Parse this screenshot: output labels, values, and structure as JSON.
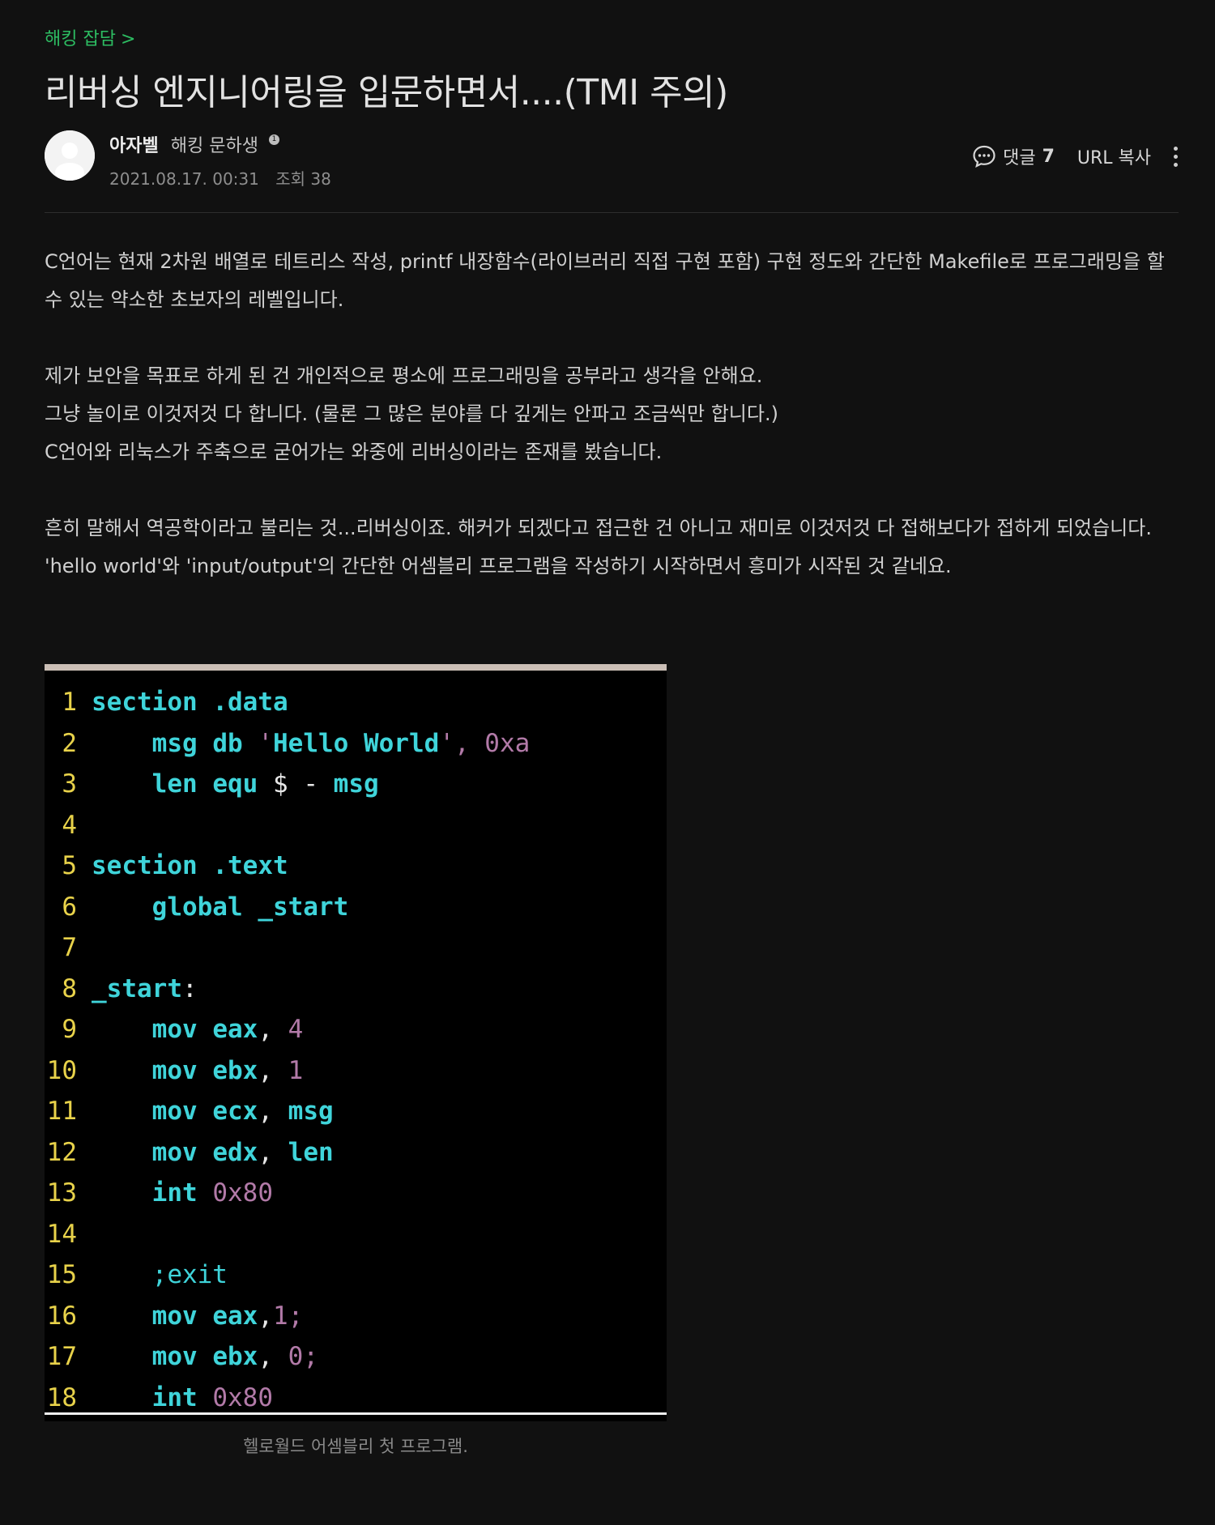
{
  "category": {
    "label": "해킹 잡담",
    "chevron": ">"
  },
  "post": {
    "title": "리버싱 엔지니어링을 입문하면서....(TMI 주의)",
    "author": {
      "name": "아자벨",
      "rank": "해킹 문하생",
      "badge": "1"
    },
    "date": "2021.08.17. 00:31",
    "views": "조회 38"
  },
  "actions": {
    "comment_label": "댓글",
    "comment_count": "7",
    "url_copy": "URL 복사"
  },
  "body": {
    "para1": "C언어는 현재 2차원 배열로 테트리스 작성, printf 내장함수(라이브러리 직접 구현 포함) 구현 정도와 간단한 Makefile로 프로그래밍을 할 수 있는 약소한 초보자의 레벨입니다.",
    "para2_line1": "제가 보안을 목표로 하게 된 건 개인적으로 평소에 프로그래밍을 공부라고 생각을 안해요.",
    "para2_line2": "그냥 놀이로 이것저것 다 합니다. (물론 그 많은 분야를 다 깊게는 안파고 조금씩만 합니다.)",
    "para2_line3": "C언어와 리눅스가 주축으로 굳어가는 와중에 리버싱이라는 존재를 봤습니다.",
    "para3_line1": "흔히 말해서 역공학이라고 불리는 것...리버싱이죠. 해커가 되겠다고 접근한 건 아니고 재미로 이것저것 다 접해보다가 접하게 되었습니다.",
    "para3_line2": "'hello world'와 'input/output'의 간단한 어셈블리 프로그램을 작성하기 시작하면서 흥미가 시작된 것 같네요."
  },
  "code": {
    "lines": [
      {
        "n": "1",
        "t": [
          [
            "kw",
            "section"
          ],
          [
            "pl",
            " "
          ],
          [
            "kw",
            ".data"
          ]
        ]
      },
      {
        "n": "2",
        "t": [
          [
            "pl",
            "    "
          ],
          [
            "kw",
            "msg"
          ],
          [
            "pl",
            " "
          ],
          [
            "kw",
            "db"
          ],
          [
            "pl",
            " "
          ],
          [
            "nm",
            "'"
          ],
          [
            "kw",
            "Hello World"
          ],
          [
            "nm",
            "', 0xa"
          ]
        ]
      },
      {
        "n": "3",
        "t": [
          [
            "pl",
            "    "
          ],
          [
            "kw",
            "len"
          ],
          [
            "pl",
            " "
          ],
          [
            "kw",
            "equ"
          ],
          [
            "pl",
            " $ - "
          ],
          [
            "kw",
            "msg"
          ]
        ]
      },
      {
        "n": "4",
        "t": []
      },
      {
        "n": "5",
        "t": [
          [
            "kw",
            "section"
          ],
          [
            "pl",
            " "
          ],
          [
            "kw",
            ".text"
          ]
        ]
      },
      {
        "n": "6",
        "t": [
          [
            "pl",
            "    "
          ],
          [
            "kw",
            "global"
          ],
          [
            "pl",
            " "
          ],
          [
            "kw",
            "_start"
          ]
        ]
      },
      {
        "n": "7",
        "t": []
      },
      {
        "n": "8",
        "t": [
          [
            "kw",
            "_start"
          ],
          [
            "pl",
            ":"
          ]
        ]
      },
      {
        "n": "9",
        "t": [
          [
            "pl",
            "    "
          ],
          [
            "kw",
            "mov"
          ],
          [
            "pl",
            " "
          ],
          [
            "kw",
            "eax"
          ],
          [
            "pl",
            ", "
          ],
          [
            "nm",
            "4"
          ]
        ]
      },
      {
        "n": "10",
        "t": [
          [
            "pl",
            "    "
          ],
          [
            "kw",
            "mov"
          ],
          [
            "pl",
            " "
          ],
          [
            "kw",
            "ebx"
          ],
          [
            "pl",
            ", "
          ],
          [
            "nm",
            "1"
          ]
        ]
      },
      {
        "n": "11",
        "t": [
          [
            "pl",
            "    "
          ],
          [
            "kw",
            "mov"
          ],
          [
            "pl",
            " "
          ],
          [
            "kw",
            "ecx"
          ],
          [
            "pl",
            ", "
          ],
          [
            "kw",
            "msg"
          ]
        ]
      },
      {
        "n": "12",
        "t": [
          [
            "pl",
            "    "
          ],
          [
            "kw",
            "mov"
          ],
          [
            "pl",
            " "
          ],
          [
            "kw",
            "edx"
          ],
          [
            "pl",
            ", "
          ],
          [
            "kw",
            "len"
          ]
        ]
      },
      {
        "n": "13",
        "t": [
          [
            "pl",
            "    "
          ],
          [
            "kw",
            "int"
          ],
          [
            "pl",
            " "
          ],
          [
            "nm",
            "0x80"
          ]
        ]
      },
      {
        "n": "14",
        "t": []
      },
      {
        "n": "15",
        "t": [
          [
            "pl",
            "    "
          ],
          [
            "cm",
            ";exit"
          ]
        ]
      },
      {
        "n": "16",
        "t": [
          [
            "pl",
            "    "
          ],
          [
            "kw",
            "mov"
          ],
          [
            "pl",
            " "
          ],
          [
            "kw",
            "eax"
          ],
          [
            "pl",
            ","
          ],
          [
            "nm",
            "1;"
          ]
        ]
      },
      {
        "n": "17",
        "t": [
          [
            "pl",
            "    "
          ],
          [
            "kw",
            "mov"
          ],
          [
            "pl",
            " "
          ],
          [
            "kw",
            "ebx"
          ],
          [
            "pl",
            ", "
          ],
          [
            "nm",
            "0;"
          ]
        ]
      },
      {
        "n": "18",
        "t": [
          [
            "pl",
            "    "
          ],
          [
            "kw",
            "int"
          ],
          [
            "pl",
            " "
          ],
          [
            "nm",
            "0x80"
          ]
        ]
      }
    ],
    "caption": "헬로월드 어셈블리 첫 프로그램."
  }
}
